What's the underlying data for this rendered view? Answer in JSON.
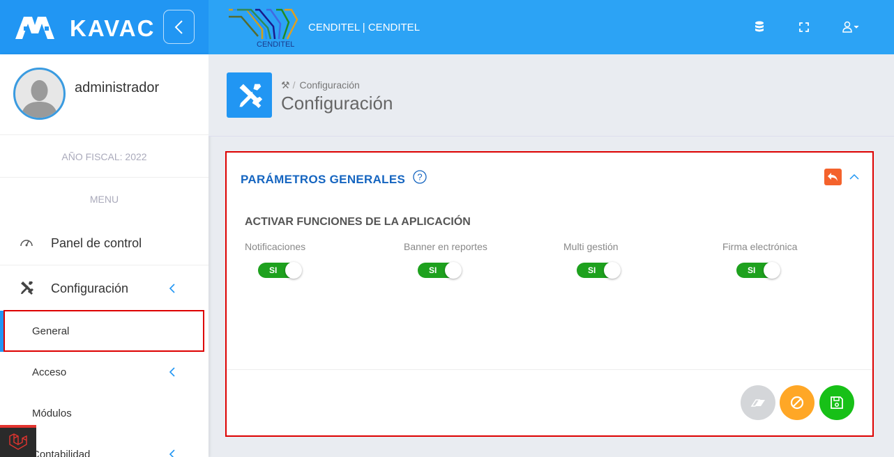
{
  "brand": {
    "name": "KAVAC"
  },
  "topbar": {
    "org_text": "CENDITEL | CENDITEL",
    "org_logo_caption": "CENDITEL"
  },
  "user": {
    "name": "administrador"
  },
  "sidebar": {
    "fiscal_year": "AÑO FISCAL: 2022",
    "menu_title": "MENU",
    "items": [
      {
        "label": "Panel de control",
        "icon": "dashboard-icon"
      },
      {
        "label": "Configuración",
        "icon": "tools-icon"
      }
    ],
    "subitems": [
      {
        "label": "General"
      },
      {
        "label": "Acceso"
      },
      {
        "label": "Módulos"
      },
      {
        "label": "Contabilidad"
      }
    ]
  },
  "page": {
    "breadcrumb": "Configuración",
    "title": "Configuración"
  },
  "card": {
    "title": "PARÁMETROS GENERALES",
    "section_title": "ACTIVAR FUNCIONES DE LA APLICACIÓN",
    "switches": [
      {
        "label": "Notificaciones",
        "state": "SI"
      },
      {
        "label": "Banner en reportes",
        "state": "SI"
      },
      {
        "label": "Multi gestión",
        "state": "SI"
      },
      {
        "label": "Firma electrónica",
        "state": "SI"
      }
    ]
  },
  "colors": {
    "primary": "#2196f3",
    "switch_on": "#1ea11e",
    "back": "#f4622c",
    "clear": "#d4d6d9",
    "cancel": "#ffa726",
    "save": "#17c017"
  }
}
